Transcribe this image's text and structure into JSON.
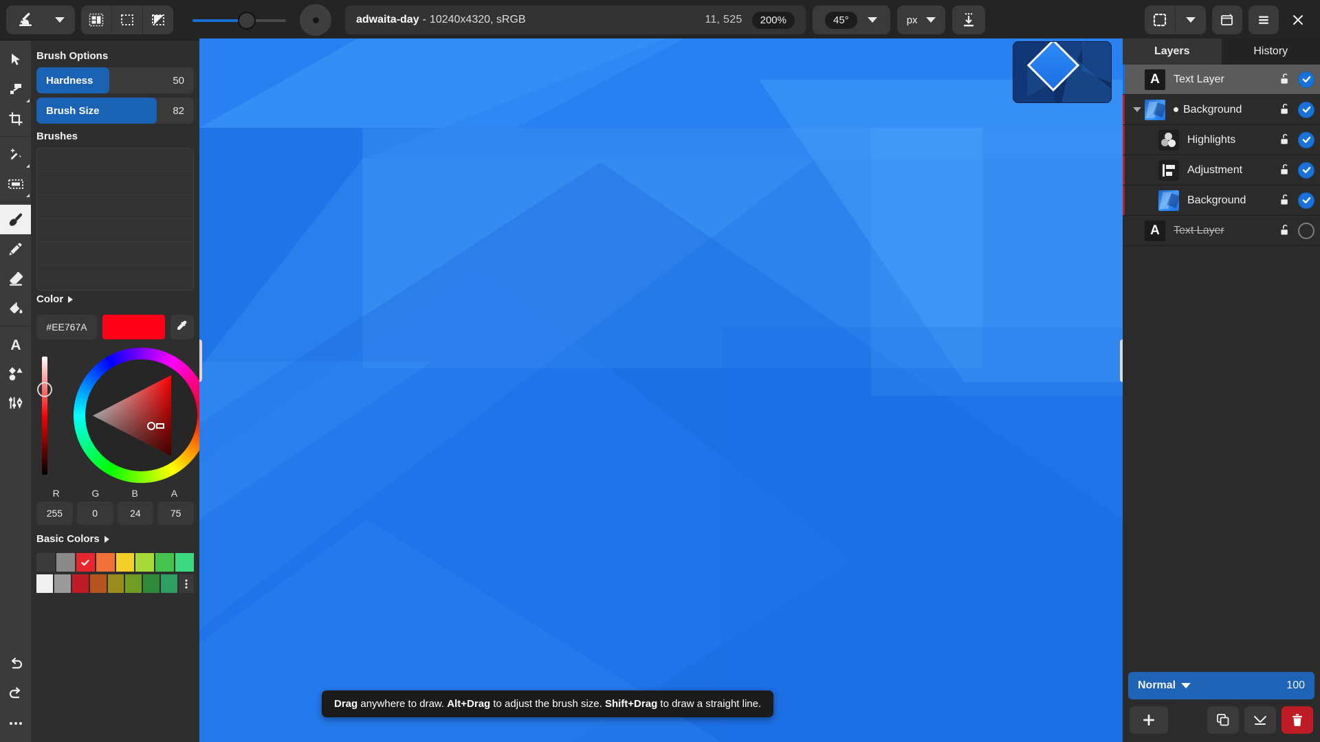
{
  "topbar": {
    "tool_dropdown_icon": "brush-stamp-icon",
    "tool_caret_icon": "chevron-down-icon",
    "layout_buttons": [
      {
        "name": "split-view-icon",
        "label": ""
      },
      {
        "name": "single-view-icon",
        "label": ""
      },
      {
        "name": "diagonal-view-icon",
        "label": ""
      }
    ],
    "slider": {
      "name": "brush-size-slider",
      "value": 55
    },
    "brush_preview": "brush-preview-circle",
    "document": {
      "title": "adwaita-day",
      "separator": " - ",
      "meta": "10240x4320, sRGB",
      "coords": "11, 525",
      "zoom": "200%"
    },
    "rotation": "45°",
    "rotation_caret_icon": "chevron-down-icon",
    "unit": "px",
    "unit_caret_icon": "chevron-down-icon",
    "export_icon": "export-download-icon",
    "right_buttons": [
      {
        "name": "selection-mode-icon"
      },
      {
        "name": "chevron-down-icon"
      },
      {
        "name": "window-snapshot-icon"
      },
      {
        "name": "hamburger-menu-icon"
      },
      {
        "name": "close-window-icon"
      }
    ]
  },
  "tools": [
    {
      "name": "tool-select-arrow",
      "icon": "cursor-arrow-icon",
      "active": false,
      "group": 0
    },
    {
      "name": "tool-transform",
      "icon": "transform-icon",
      "active": false,
      "group": 0,
      "corner": true
    },
    {
      "name": "tool-crop",
      "icon": "crop-icon",
      "active": false,
      "group": 0
    },
    {
      "name": "tool-magic-wand",
      "icon": "magic-wand-icon",
      "active": false,
      "group": 1,
      "corner": true
    },
    {
      "name": "tool-marquee-select",
      "icon": "rectangle-select-icon",
      "active": false,
      "group": 1,
      "corner": true
    },
    {
      "name": "tool-brush",
      "icon": "paintbrush-icon",
      "active": true,
      "group": 2
    },
    {
      "name": "tool-pencil",
      "icon": "pencil-icon",
      "active": false,
      "group": 2
    },
    {
      "name": "tool-eraser",
      "icon": "eraser-icon",
      "active": false,
      "group": 2
    },
    {
      "name": "tool-paint-bucket",
      "icon": "paint-bucket-icon",
      "active": false,
      "group": 2
    },
    {
      "name": "tool-text",
      "icon": "text-a-icon",
      "active": false,
      "group": 3
    },
    {
      "name": "tool-shapes",
      "icon": "shapes-icon",
      "active": false,
      "group": 3
    },
    {
      "name": "tool-path-pen",
      "icon": "pen-path-icon",
      "active": false,
      "group": 3
    }
  ],
  "tool_bottom": [
    {
      "name": "undo-button",
      "icon": "undo-arrow-icon"
    },
    {
      "name": "redo-button",
      "icon": "redo-arrow-icon"
    },
    {
      "name": "more-tools-button",
      "icon": "ellipsis-icon"
    }
  ],
  "options": {
    "brush_options_title": "Brush Options",
    "rows": [
      {
        "name": "hardness-slider",
        "label": "Hardness",
        "value": "50",
        "pct": 50
      },
      {
        "name": "brush-size-slider-row",
        "label": "Brush Size",
        "value": "82",
        "pct": 82
      }
    ],
    "brushes_title": "Brushes",
    "color_title": "Color",
    "color_chevron_icon": "chevron-right-icon",
    "hex": "#EE767A",
    "swatch_color": "#FF0018",
    "eyedropper_icon": "eyedropper-icon",
    "channels": [
      "R",
      "G",
      "B",
      "A"
    ],
    "channel_values": [
      "255",
      "0",
      "24",
      "75"
    ],
    "basic_colors_title": "Basic Colors",
    "basic_chevron_icon": "chevron-right-icon",
    "swatches_row1": [
      "#3b3b3b",
      "#8a8a8a",
      "#e8262f",
      "#f07238",
      "#f5d02a",
      "#a8d93a",
      "#46c24f",
      "#3ad97e"
    ],
    "swatches_row2": [
      "#f0f0f0",
      "#9a9a9a",
      "#c01c28",
      "#b5541f",
      "#9a8c1c",
      "#6f9c22",
      "#2e8a3a",
      "#2f9e63"
    ],
    "selected_swatch_index": 2,
    "more_swatches_icon": "vertical-ellipsis-icon"
  },
  "canvas": {
    "navigator_name": "navigator-minimap",
    "viewport_name": "navigator-viewport",
    "tooltip": {
      "a1": "Drag",
      "a2": " anywhere to draw. ",
      "b1": "Alt+Drag",
      "b2": " to adjust the brush size. ",
      "c1": "Shift+Drag",
      "c2": " to draw a straight line."
    }
  },
  "layers_panel": {
    "tabs": [
      {
        "name": "tab-layers",
        "label": "Layers",
        "active": true
      },
      {
        "name": "tab-history",
        "label": "History",
        "active": false
      }
    ],
    "layers": [
      {
        "name": "Text Layer",
        "icon": "text-a-icon",
        "selected": true,
        "visible": true,
        "locked": false,
        "indent": 0,
        "edge": "#1a6fd4",
        "twisty": false,
        "dot": false,
        "struck": false
      },
      {
        "name": "Background",
        "icon": "image-thumb-icon",
        "selected": false,
        "visible": true,
        "locked": false,
        "indent": 0,
        "edge": "#c01c28",
        "twisty": true,
        "dot": true,
        "struck": false
      },
      {
        "name": "Highlights",
        "icon": "circles-icon",
        "selected": false,
        "visible": true,
        "locked": false,
        "indent": 1,
        "edge": "#c01c28",
        "twisty": false,
        "dot": false,
        "struck": false
      },
      {
        "name": "Adjustment",
        "icon": "adjustment-icon",
        "selected": false,
        "visible": true,
        "locked": false,
        "indent": 1,
        "edge": "#c01c28",
        "twisty": false,
        "dot": false,
        "struck": false
      },
      {
        "name": "Background",
        "icon": "image-thumb-icon",
        "selected": false,
        "visible": true,
        "locked": false,
        "indent": 1,
        "edge": "#c01c28",
        "twisty": false,
        "dot": false,
        "struck": false
      },
      {
        "name": "Text Layer",
        "icon": "text-a-icon",
        "selected": false,
        "visible": false,
        "locked": false,
        "indent": 0,
        "edge": "#2b2b2b",
        "twisty": false,
        "dot": false,
        "struck": true
      }
    ],
    "blend_mode": "Normal",
    "blend_caret_icon": "chevron-down-icon",
    "opacity": "100",
    "actions": [
      {
        "name": "add-layer-button",
        "icon": "plus-icon"
      },
      {
        "name": "duplicate-layer-button",
        "icon": "duplicate-icon"
      },
      {
        "name": "merge-layer-button",
        "icon": "merge-down-icon"
      },
      {
        "name": "delete-layer-button",
        "icon": "trash-icon"
      }
    ]
  }
}
